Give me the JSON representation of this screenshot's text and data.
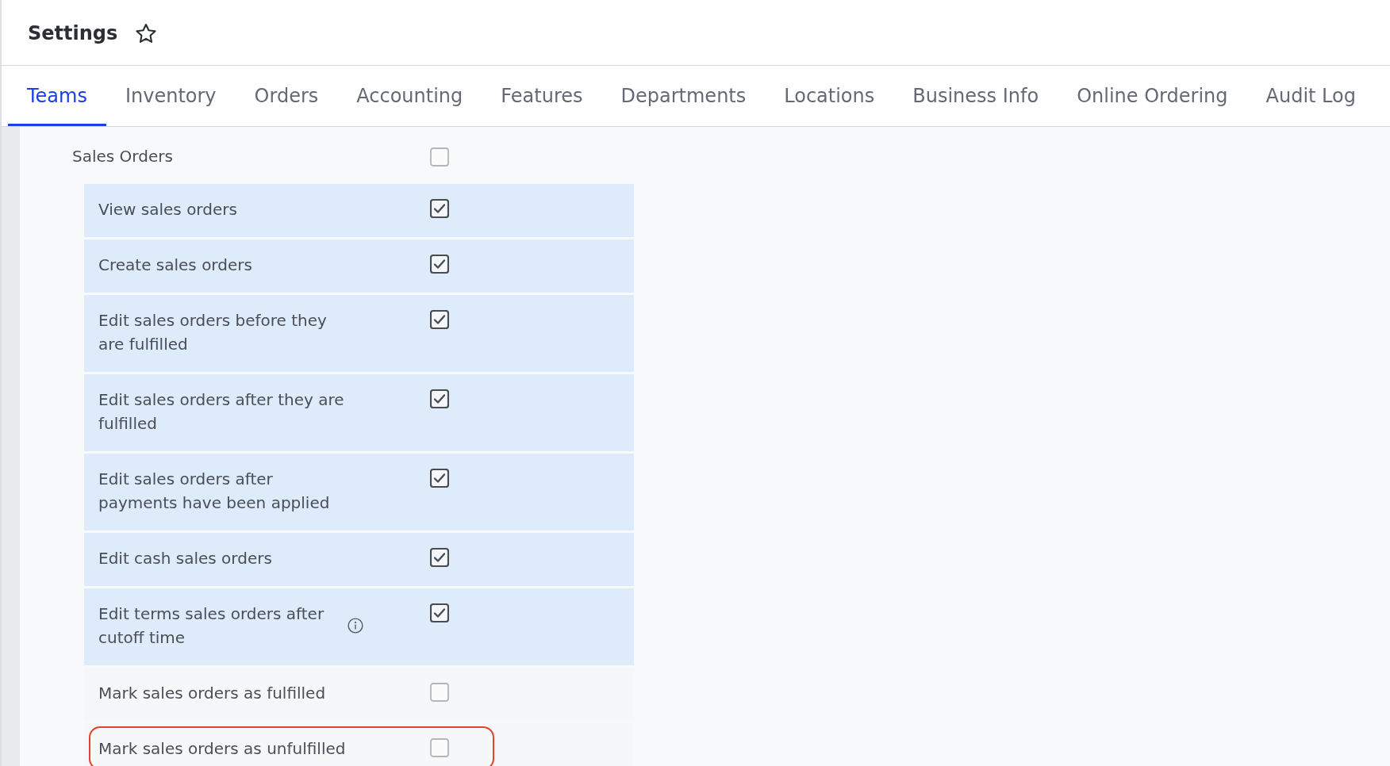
{
  "page": {
    "title": "Settings",
    "favorite": false
  },
  "tabs": [
    {
      "label": "Teams",
      "selected": true
    },
    {
      "label": "Inventory",
      "selected": false
    },
    {
      "label": "Orders",
      "selected": false
    },
    {
      "label": "Accounting",
      "selected": false
    },
    {
      "label": "Features",
      "selected": false
    },
    {
      "label": "Departments",
      "selected": false
    },
    {
      "label": "Locations",
      "selected": false
    },
    {
      "label": "Business Info",
      "selected": false
    },
    {
      "label": "Online Ordering",
      "selected": false
    },
    {
      "label": "Audit Log",
      "selected": false
    }
  ],
  "permission_group": {
    "label": "Sales Orders",
    "checked": false,
    "items": [
      {
        "label": "View sales orders",
        "checked": true,
        "info": false,
        "highlighted": false
      },
      {
        "label": "Create sales orders",
        "checked": true,
        "info": false,
        "highlighted": false
      },
      {
        "label": "Edit sales orders before they are fulfilled",
        "checked": true,
        "info": false,
        "highlighted": false
      },
      {
        "label": "Edit sales orders after they are fulfilled",
        "checked": true,
        "info": false,
        "highlighted": false
      },
      {
        "label": "Edit sales orders after payments have been applied",
        "checked": true,
        "info": false,
        "highlighted": false
      },
      {
        "label": "Edit cash sales orders",
        "checked": true,
        "info": false,
        "highlighted": false
      },
      {
        "label": "Edit terms sales orders after cutoff time",
        "checked": true,
        "info": true,
        "highlighted": false
      },
      {
        "label": "Mark sales orders as fulfilled",
        "checked": false,
        "info": false,
        "highlighted": false
      },
      {
        "label": "Mark sales orders as unfulfilled",
        "checked": false,
        "info": false,
        "highlighted": true
      }
    ]
  }
}
